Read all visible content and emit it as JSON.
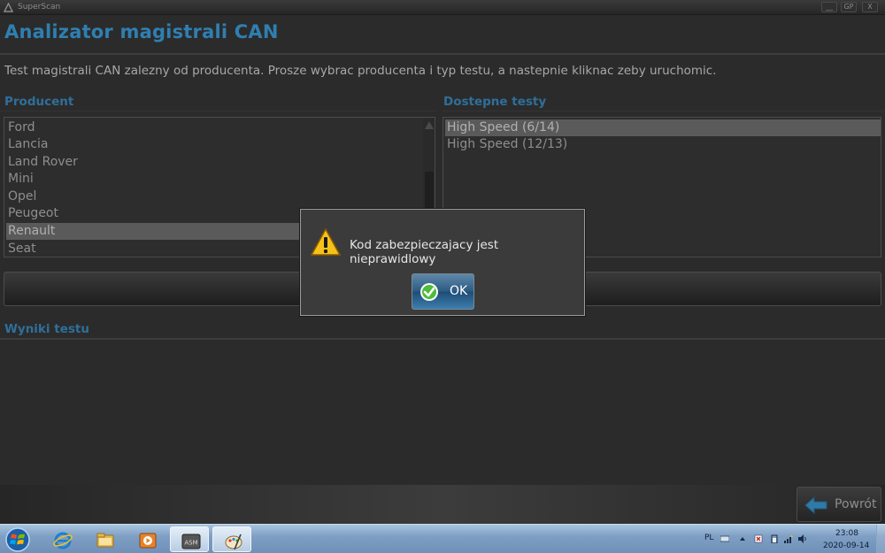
{
  "window": {
    "title": "SuperScan",
    "controls": [
      "__",
      "GP",
      "X"
    ]
  },
  "header": {
    "title": "Analizator magistrali CAN"
  },
  "instruction": "Test magistrali CAN zalezny od producenta. Prosze wybrac producenta i typ testu, a nastepnie kliknac zeby uruchomic.",
  "producer": {
    "label": "Producent",
    "items": [
      "Ford",
      "Lancia",
      "Land Rover",
      "Mini",
      "Opel",
      "Peugeot",
      "Renault",
      "Seat"
    ],
    "selected": "Renault"
  },
  "tests": {
    "label": "Dostepne testy",
    "items": [
      "High Speed (6/14)",
      "High Speed (12/13)"
    ],
    "selected": "High Speed (6/14)"
  },
  "results": {
    "label": "Wyniki testu"
  },
  "back_button": {
    "label": "Powrót"
  },
  "dialog": {
    "message": "Kod zabezpieczajacy jest nieprawidlowy",
    "ok_label": "OK"
  },
  "taskbar": {
    "apps": [
      "start-orb",
      "internet-explorer-icon",
      "file-explorer-icon",
      "media-player-icon",
      "asm-app-icon",
      "paint-icon"
    ],
    "active_app": "asm-app-icon",
    "language": "PL",
    "time": "23:08",
    "date": "2020-09-14"
  },
  "colors": {
    "title_blue": "#2f7fb0",
    "section_blue": "#2f6f9a",
    "background": "#2b2b2b"
  }
}
